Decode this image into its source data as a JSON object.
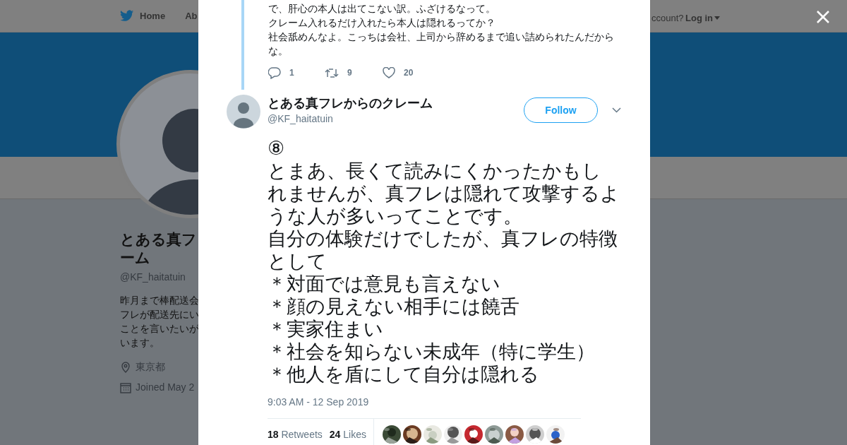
{
  "header": {
    "nav": [
      {
        "label": "Home"
      },
      {
        "label": "Ab"
      }
    ],
    "account_prompt": "ccount?",
    "login": "Log in"
  },
  "profile": {
    "name_lines": [
      "とある真フ",
      "ーム"
    ],
    "handle": "@KF_haitatuin",
    "bio_lines": [
      "昨月まで棒配送会",
      "フレが配送先にい",
      "ことを言いたいが",
      "います。"
    ],
    "location": "東京都",
    "joined": "Joined May 2"
  },
  "modal": {
    "previous_tweet": {
      "lines": [
        "で、肝心の本人は出てこない訳。ふざけるなって。",
        "クレーム入れるだけ入れたら本人は隠れるってか？",
        "社会舐めんなよ。こっちは会社、上司から辞めるまで追い詰められたんだから",
        "な。"
      ],
      "replies": "1",
      "retweets": "9",
      "likes": "20"
    },
    "tweet": {
      "name": "とある真フレからのクレーム",
      "handle": "@KF_haitatuin",
      "follow": "Follow",
      "text_lines": [
        "⑧",
        "とまあ、長くて読みにくかったかもしれませんが、真フレは隠れて攻撃するような人が多いってことです。",
        "自分の体験だけでしたが、真フレの特徴として",
        "＊対面では意見も言えない",
        "＊顔の見えない相手には饒舌",
        "＊実家住まい",
        "＊社会を知らない未成年（特に学生）",
        "＊他人を盾にして自分は隠れる"
      ],
      "time": "9:03 AM - 12 Sep 2019",
      "retweet_count": "18",
      "retweet_label": "Retweets",
      "like_count": "24",
      "like_label": "Likes",
      "liker_avatars": [
        {
          "kind": "picture"
        },
        {
          "kind": "picture"
        },
        {
          "kind": "picture"
        },
        {
          "kind": "picture"
        },
        {
          "kind": "picture"
        },
        {
          "kind": "picture"
        },
        {
          "kind": "picture"
        },
        {
          "kind": "picture"
        },
        {
          "kind": "picture"
        }
      ]
    }
  }
}
